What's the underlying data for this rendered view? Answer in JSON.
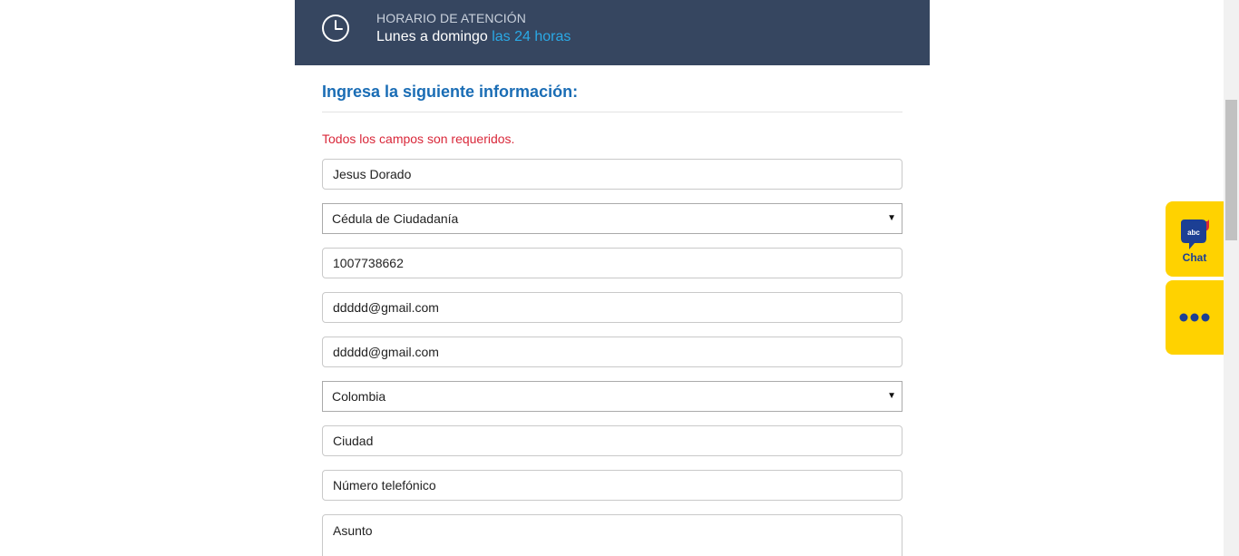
{
  "hours": {
    "title": "HORARIO DE ATENCIÓN",
    "days": "Lunes a domingo",
    "time": "las 24 horas",
    "icon": "clock-icon"
  },
  "form": {
    "title": "Ingresa la siguiente información:",
    "required_note": "Todos los campos son requeridos.",
    "name_value": "Jesus Dorado",
    "doc_type_selected": "Cédula de Ciudadanía",
    "doc_number_value": "1007738662",
    "email_value": "ddddd@gmail.com",
    "email_confirm_value": "ddddd@gmail.com",
    "country_selected": "Colombia",
    "city_placeholder": "Ciudad",
    "phone_placeholder": "Número telefónico",
    "subject_placeholder": "Asunto"
  },
  "widgets": {
    "chat_label": "Chat",
    "chat_badge": "abc",
    "chat_icon": "chat-bubble-icon",
    "more_icon": "more-dots-icon"
  },
  "colors": {
    "banner": "#364660",
    "accent_blue": "#2aa9e6",
    "title_blue": "#1a6db5",
    "error_red": "#d9283a",
    "widget_yellow": "#ffd200",
    "widget_navy": "#1c3f94"
  }
}
